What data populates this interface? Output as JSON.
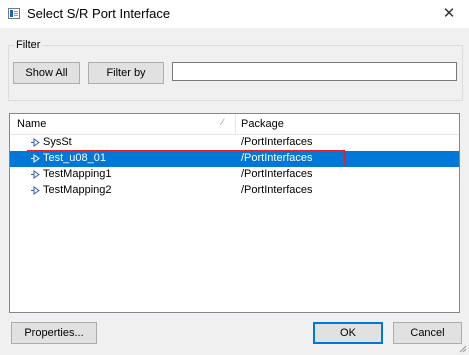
{
  "window": {
    "title": "Select S/R Port Interface",
    "close_glyph": "✕"
  },
  "filter": {
    "group_label": "Filter",
    "show_all_label": "Show All",
    "filter_by_label": "Filter by",
    "input_value": ""
  },
  "list": {
    "columns": {
      "name": "Name",
      "package": "Package"
    },
    "rows": [
      {
        "name": "SysSt",
        "package": "/PortInterfaces",
        "selected": false
      },
      {
        "name": "Test_u08_01",
        "package": "/PortInterfaces",
        "selected": true
      },
      {
        "name": "TestMapping1",
        "package": "/PortInterfaces",
        "selected": false
      },
      {
        "name": "TestMapping2",
        "package": "/PortInterfaces",
        "selected": false
      }
    ]
  },
  "buttons": {
    "properties": "Properties...",
    "ok": "OK",
    "cancel": "Cancel"
  },
  "colors": {
    "selection": "#0078d7",
    "highlight_outline": "#e0202a",
    "ok_border": "#0078d7"
  },
  "icons": {
    "window": "dialog-icon",
    "row": "port-interface-icon",
    "close": "close-icon"
  }
}
